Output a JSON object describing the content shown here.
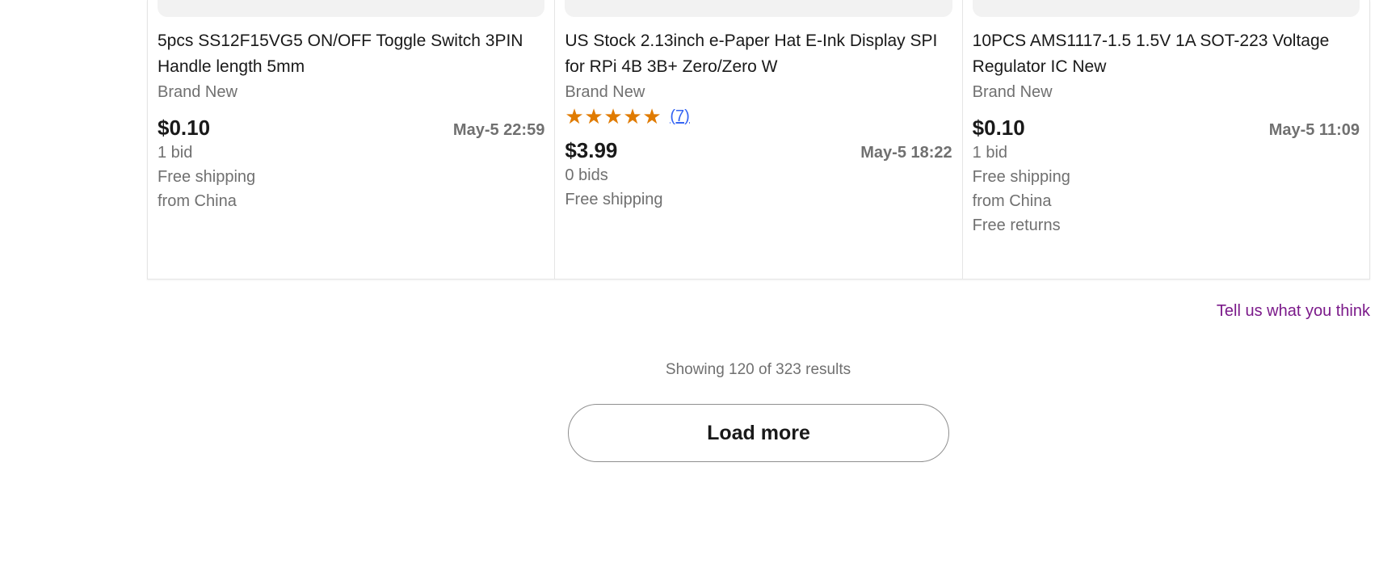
{
  "listings": [
    {
      "title": "5pcs SS12F15VG5 ON/OFF Toggle Switch 3PIN Handle length 5mm",
      "condition": "Brand New",
      "price": "$0.10",
      "time_left": "May-5 22:59",
      "bids": "1 bid",
      "shipping": "Free shipping",
      "location": "from China"
    },
    {
      "title": "US Stock 2.13inch e-Paper Hat E-Ink Display SPI for RPi 4B 3B+ Zero/Zero W",
      "condition": "Brand New",
      "rating_stars": 5,
      "review_count": "(7)",
      "price": "$3.99",
      "time_left": "May-5 18:22",
      "bids": "0 bids",
      "shipping": "Free shipping"
    },
    {
      "title": "10PCS AMS1117-1.5 1.5V 1A SOT-223 Voltage Regulator IC New",
      "condition": "Brand New",
      "price": "$0.10",
      "time_left": "May-5 11:09",
      "bids": "1 bid",
      "shipping": "Free shipping",
      "location": "from China",
      "returns": "Free returns"
    }
  ],
  "feedback_link": "Tell us what you think",
  "results_text": "Showing 120 of 323 results",
  "load_more_label": "Load more",
  "colors": {
    "star": "#e07b00",
    "link_blue": "#3665f3",
    "feedback_purple": "#7b1a8a",
    "secondary_text": "#707070"
  }
}
